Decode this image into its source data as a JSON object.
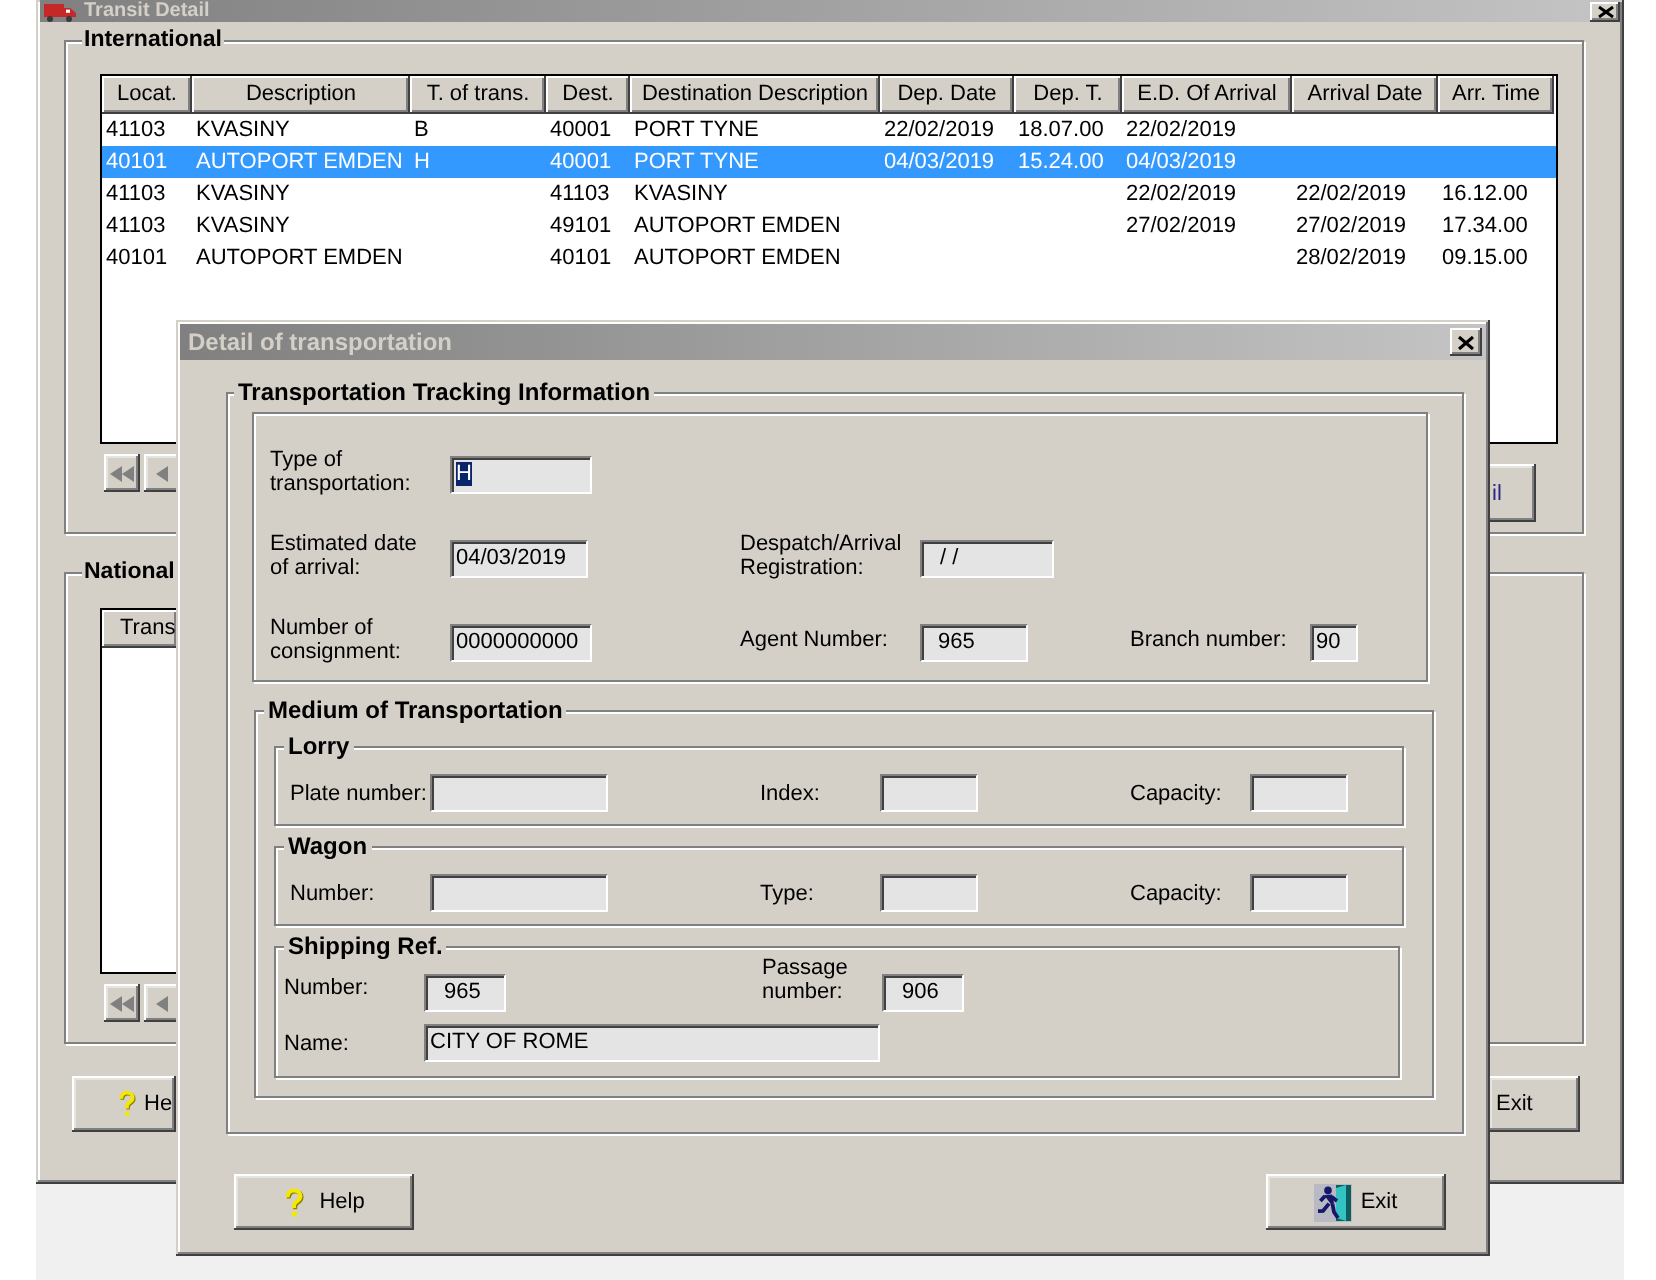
{
  "main_window": {
    "title": "Transit Detail",
    "international": {
      "label": "International",
      "columns": [
        "Locat.",
        "Description",
        "T. of trans.",
        "Dest.",
        "Destination Description",
        "Dep. Date",
        "Dep. T.",
        "E.D. Of Arrival",
        "Arrival Date",
        "Arr. Time"
      ],
      "rows": [
        {
          "cells": [
            "41103",
            "KVASINY",
            "B",
            "40001",
            "PORT TYNE",
            "22/02/2019",
            "18.07.00",
            "22/02/2019",
            null,
            null
          ],
          "selected": false
        },
        {
          "cells": [
            "40101",
            "AUTOPORT EMDEN",
            "H",
            "40001",
            "PORT TYNE",
            "04/03/2019",
            "15.24.00",
            "04/03/2019",
            null,
            null
          ],
          "selected": true
        },
        {
          "cells": [
            "41103",
            "KVASINY",
            null,
            "41103",
            "KVASINY",
            null,
            null,
            "22/02/2019",
            "22/02/2019",
            "16.12.00"
          ],
          "selected": false
        },
        {
          "cells": [
            "41103",
            "KVASINY",
            null,
            "49101",
            "AUTOPORT EMDEN",
            null,
            null,
            "27/02/2019",
            "27/02/2019",
            "17.34.00"
          ],
          "selected": false
        },
        {
          "cells": [
            "40101",
            "AUTOPORT EMDEN",
            null,
            "40101",
            "AUTOPORT EMDEN",
            null,
            null,
            null,
            "28/02/2019",
            "09.15.00"
          ],
          "selected": false
        }
      ],
      "side_button": "il"
    },
    "national": {
      "label": "National",
      "columns": [
        "Trans"
      ]
    },
    "buttons": [
      {
        "label": "He",
        "kind": "help"
      },
      {
        "label": "Exit",
        "kind": "exit"
      }
    ]
  },
  "dialog": {
    "title": "Detail of transportation",
    "tracking": {
      "label": "Transportation Tracking Information",
      "rows": [
        {
          "fields": [
            {
              "label": "Type of\ntransportation:",
              "value": "H",
              "focused": true
            }
          ]
        },
        {
          "fields": [
            {
              "label": "Estimated date\nof arrival:",
              "value": "04/03/2019",
              "focused": false
            },
            {
              "label": "Despatch/Arrival\nRegistration:",
              "value": "/ /",
              "focused": false
            }
          ]
        },
        {
          "fields": [
            {
              "label": "Number of\nconsignment:",
              "value": "0000000000",
              "focused": false
            },
            {
              "label": "Agent Number:",
              "value": "965",
              "focused": false
            },
            {
              "label": "Branch number:",
              "value": "90",
              "focused": false
            }
          ]
        }
      ]
    },
    "medium": {
      "label": "Medium of Transportation",
      "groups": [
        {
          "label": "Lorry",
          "rows": [
            {
              "fields": [
                {
                  "label": "Plate number:"
                },
                {
                  "label": "Index:"
                },
                {
                  "label": "Capacity:"
                }
              ]
            }
          ]
        },
        {
          "label": "Wagon",
          "rows": [
            {
              "fields": [
                {
                  "label": "Number:"
                },
                {
                  "label": "Type:"
                },
                {
                  "label": "Capacity:"
                }
              ]
            }
          ]
        },
        {
          "label": "Shipping Ref.",
          "rows": [
            {
              "fields": [
                {
                  "label": "Number:",
                  "value": "965"
                },
                {
                  "label": "Passage\nnumber:",
                  "value": "906"
                }
              ]
            },
            {
              "fields": [
                {
                  "label": "Name:",
                  "value": "CITY OF ROME"
                }
              ]
            }
          ]
        }
      ]
    },
    "buttons": [
      {
        "label": "Help",
        "kind": "help"
      },
      {
        "label": "Exit",
        "kind": "exit"
      }
    ]
  }
}
